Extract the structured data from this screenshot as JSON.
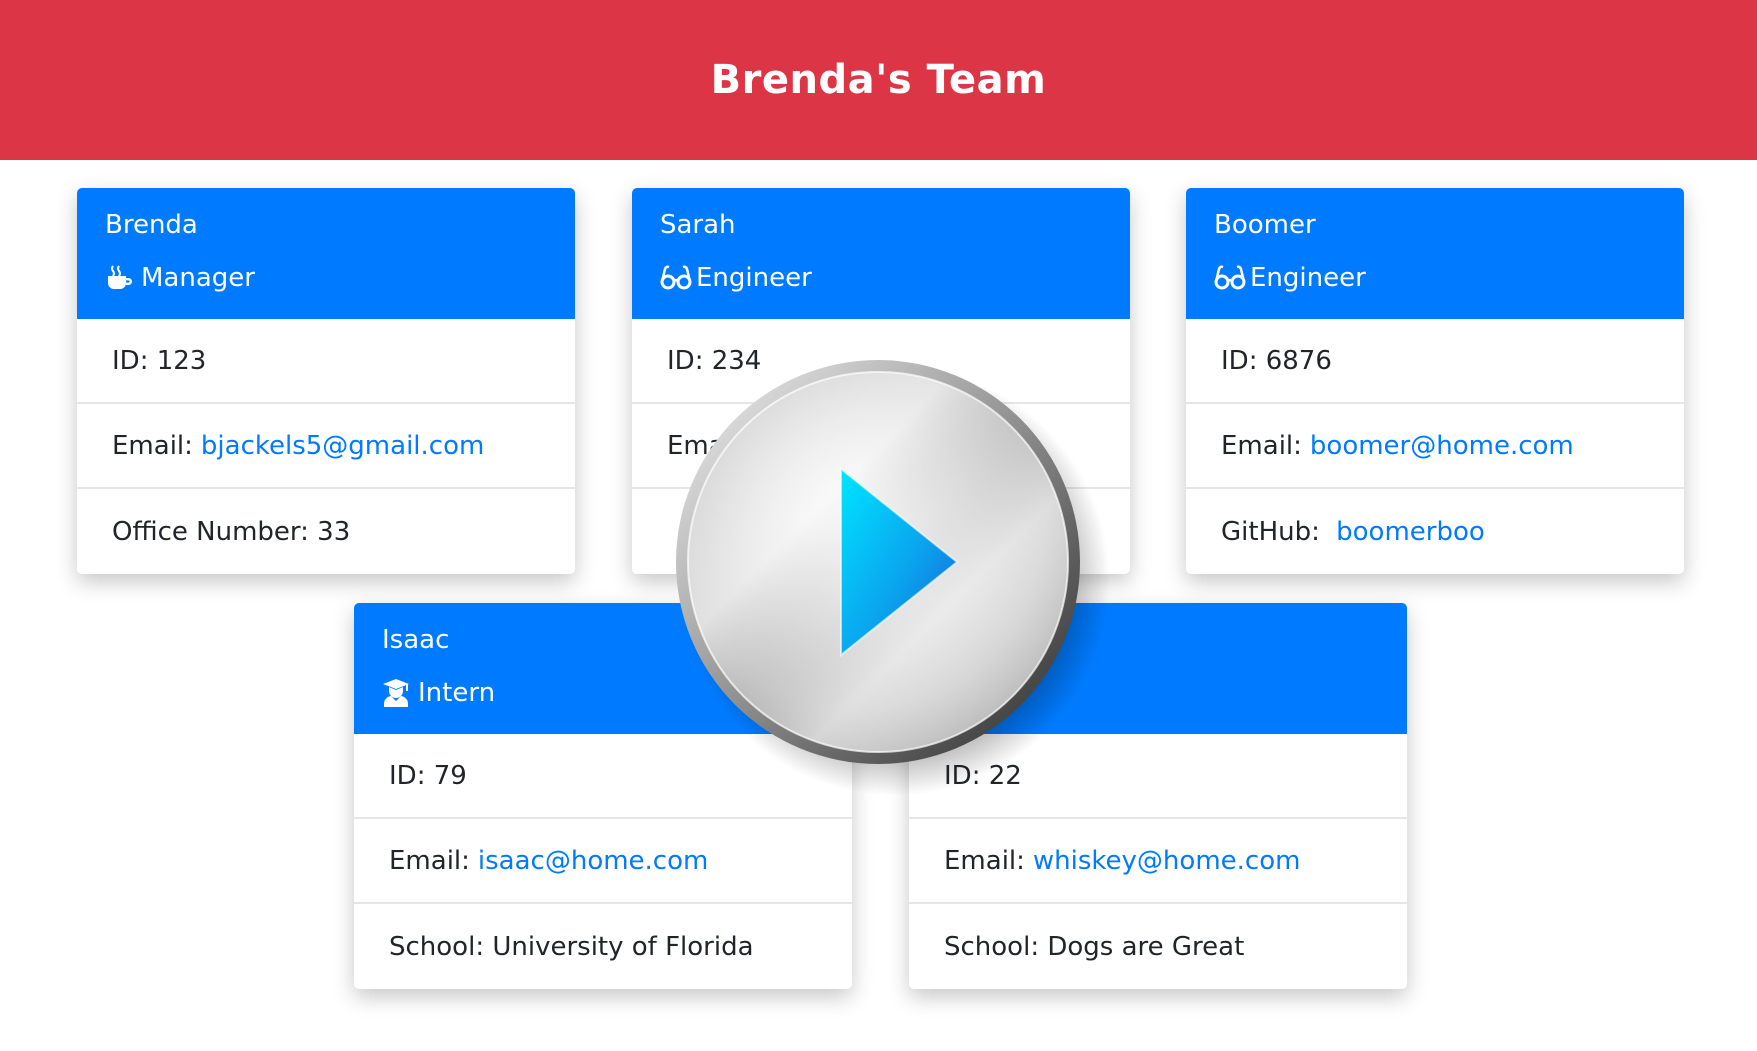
{
  "header": {
    "title": "Brenda's Team"
  },
  "cards": [
    {
      "name": "Brenda",
      "role": "Manager",
      "role_icon": "coffee-icon",
      "id_label": "ID:",
      "id": "123",
      "email_label": "Email:",
      "email": "bjackels5@gmail.com",
      "extra_label": "Office Number:",
      "extra": "33"
    },
    {
      "name": "Sarah",
      "role": "Engineer",
      "role_icon": "glasses-icon",
      "id_label": "ID:",
      "id": "234",
      "email_label": "Email:",
      "email": "",
      "extra_label": "",
      "extra": ""
    },
    {
      "name": "Boomer",
      "role": "Engineer",
      "role_icon": "glasses-icon",
      "id_label": "ID:",
      "id": "6876",
      "email_label": "Email:",
      "email": "boomer@home.com",
      "extra_label": "GitHub:",
      "extra": "boomerboo"
    },
    {
      "name": "Isaac",
      "role": "Intern",
      "role_icon": "graduate-icon",
      "id_label": "ID:",
      "id": "79",
      "email_label": "Email:",
      "email": "isaac@home.com",
      "extra_label": "School:",
      "extra": "University of Florida"
    },
    {
      "name": "",
      "role": "",
      "role_icon": "",
      "id_label": "ID:",
      "id": "22",
      "email_label": "Email:",
      "email": "whiskey@home.com",
      "extra_label": "School:",
      "extra": "Dogs are Great"
    }
  ],
  "overlay": {
    "icon": "play-icon"
  },
  "colors": {
    "header_bg": "#dc3545",
    "card_header_bg": "#007bff",
    "link": "#007bff"
  }
}
